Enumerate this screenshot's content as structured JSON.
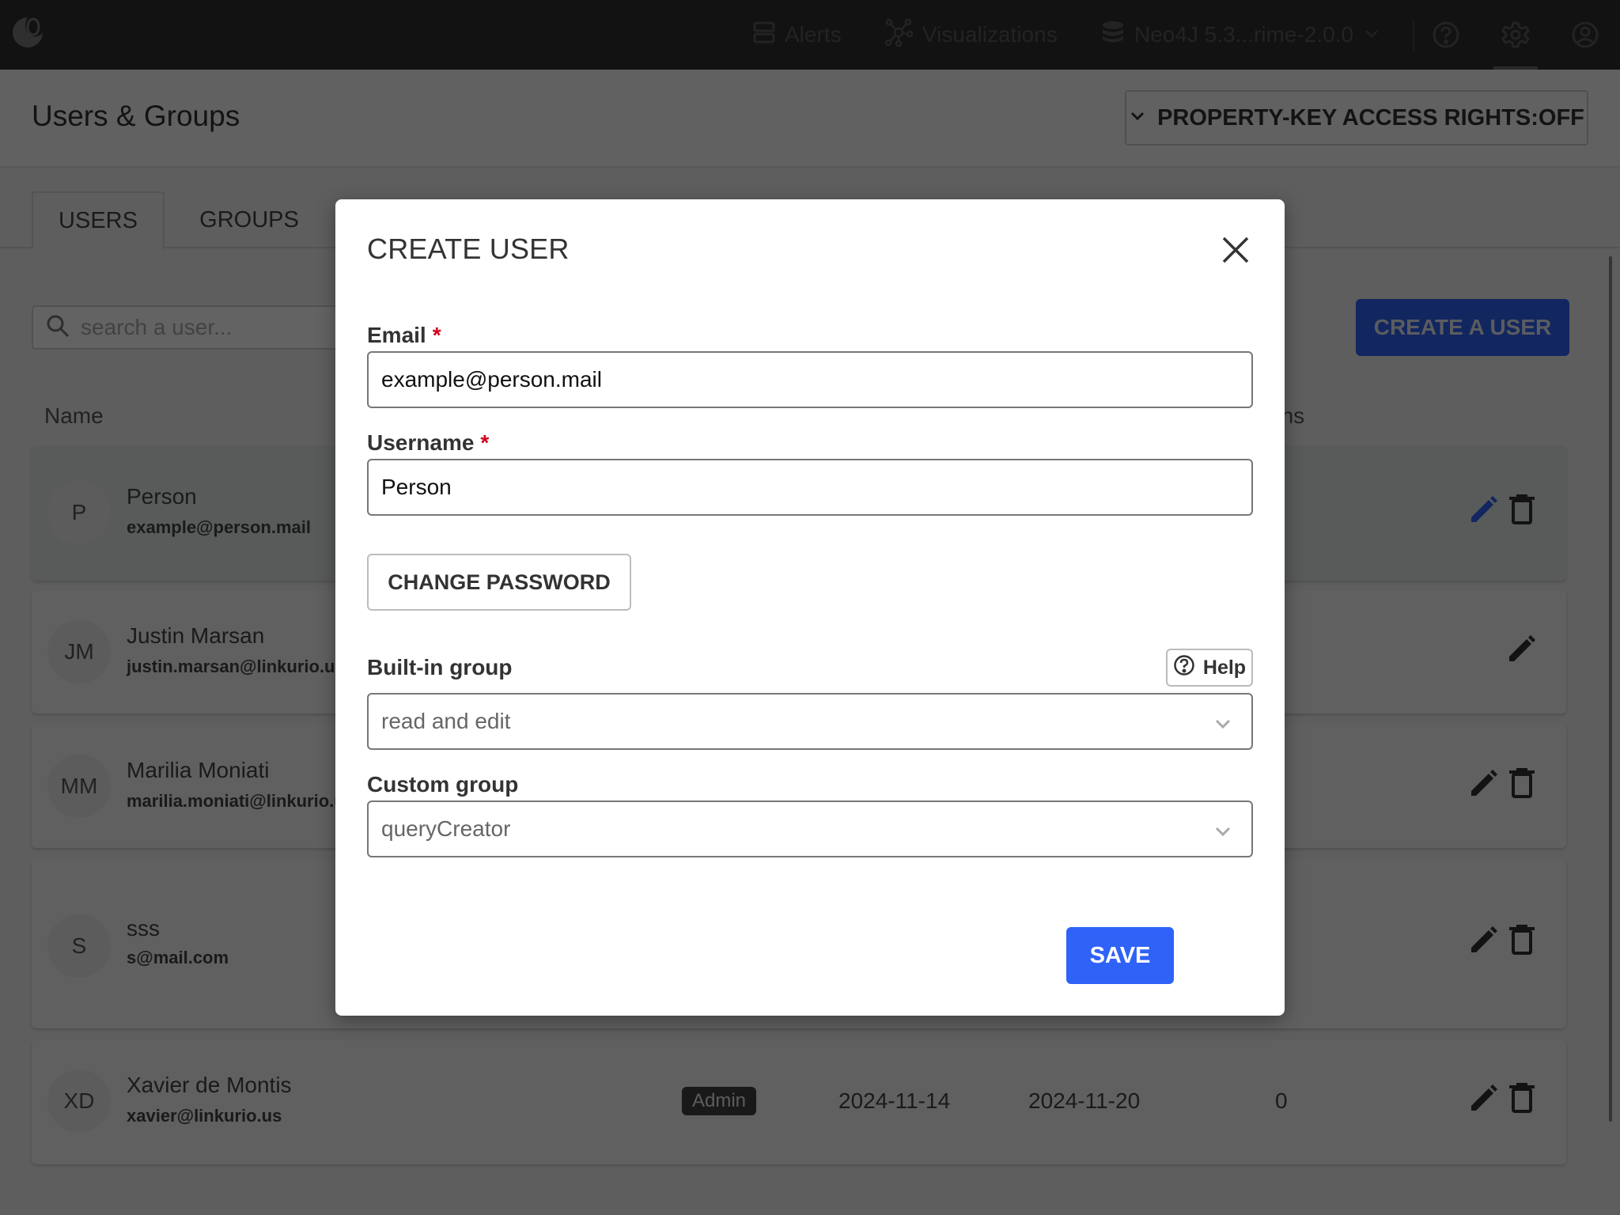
{
  "nav": {
    "logo": "linkurious-logo",
    "alerts_label": "Alerts",
    "visualizations_label": "Visualizations",
    "datasource_label": "Neo4J 5.3...rime-2.0.0"
  },
  "header": {
    "title": "Users & Groups",
    "property_key_button": "PROPERTY-KEY ACCESS RIGHTS:OFF"
  },
  "tabs": [
    {
      "label": "USERS",
      "active": true
    },
    {
      "label": "GROUPS",
      "active": false
    }
  ],
  "toolbar": {
    "search_placeholder": "search a user...",
    "create_user_label": "CREATE A USER"
  },
  "table": {
    "columns": {
      "name": "Name",
      "visualizations": "Visualizations",
      "visualizations_visible": "lizations"
    },
    "rows": [
      {
        "initials": "P",
        "name": "Person",
        "email": "example@person.mail",
        "selected": true,
        "actions": [
          "edit",
          "delete"
        ]
      },
      {
        "initials": "JM",
        "name": "Justin Marsan",
        "email": "justin.marsan@linkurio.us",
        "actions": [
          "edit"
        ]
      },
      {
        "initials": "MM",
        "name": "Marilia Moniati",
        "email": "marilia.moniati@linkurio.us",
        "actions": [
          "edit",
          "delete"
        ]
      },
      {
        "initials": "S",
        "name": "sss",
        "email": "s@mail.com",
        "actions": [
          "edit",
          "delete"
        ]
      },
      {
        "initials": "XD",
        "name": "Xavier de Montis",
        "email": "xavier@linkurio.us",
        "badge": "Admin",
        "created": "2024-11-14",
        "last_login": "2024-11-20",
        "visualizations": "0",
        "actions": [
          "edit",
          "delete"
        ]
      }
    ]
  },
  "modal": {
    "title": "CREATE USER",
    "email_label": "Email",
    "email_value": "example@person.mail",
    "username_label": "Username",
    "username_value": "Person",
    "required_marker": "*",
    "change_password_label": "CHANGE PASSWORD",
    "builtin_group_label": "Built-in group",
    "builtin_group_value": "read and edit",
    "help_label": "Help",
    "custom_group_label": "Custom group",
    "custom_group_value": "queryCreator",
    "save_label": "SAVE"
  },
  "colors": {
    "primary": "#2f62f7",
    "required": "#d0021b",
    "topbar": "#303030"
  }
}
